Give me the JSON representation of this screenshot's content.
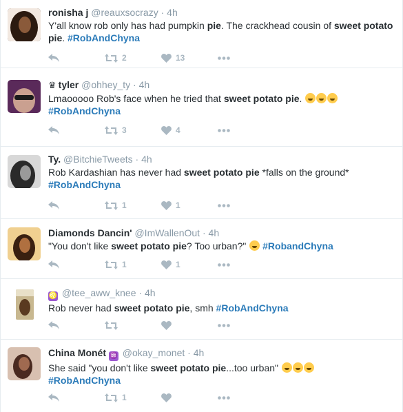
{
  "tweets": [
    {
      "name": "ronisha j",
      "handle": "@reauxsocrazy",
      "time": "4h",
      "text": {
        "t1": "Y'all know rob only has had pumpkin ",
        "b1": "pie",
        "t2": ". The crackhead cousin of ",
        "b2": "sweet potato pie",
        "t3": ". ",
        "hashtag": "#RobAndChyna"
      },
      "retweets": "2",
      "likes": "13",
      "avatar_color": "#3a2418"
    },
    {
      "name": "tyler",
      "handle": "@ohhey_ty",
      "time": "4h",
      "text": {
        "t1": "Lmaooooo Rob's face when he tried that ",
        "b1": "sweet potato pie",
        "t2": ". ",
        "hashtag": "#RobAndChyna"
      },
      "retweets": "3",
      "likes": "4",
      "avatar_color": "#4a2050",
      "crown_icon": "crown-icon"
    },
    {
      "name": "Ty.",
      "handle": "@BitchieTweets",
      "time": "4h",
      "text": {
        "t1": "Rob Kardashian has never had ",
        "b1": "sweet potato pie",
        "t2": " *falls on the ground*",
        "hashtag": "#RobAndChyna"
      },
      "retweets": "1",
      "likes": "1",
      "avatar_color": "#6b6b6b"
    },
    {
      "name": "Diamonds Dancin'",
      "handle": "@ImWallenOut",
      "time": "4h",
      "text": {
        "t1": "\"You don't like ",
        "b1": "sweet potato pie",
        "t2": "? Too urban?\"",
        "hashtag": "#RobandChyna"
      },
      "retweets": "1",
      "likes": "1",
      "avatar_color": "#c98a3a"
    },
    {
      "name": "",
      "handle": "@tee_aww_knee",
      "time": "4h",
      "text": {
        "t1": "Rob never had ",
        "b1": "sweet potato pie",
        "t2": ", smh ",
        "hashtag": "#RobAndChyna"
      },
      "retweets": "",
      "likes": "",
      "avatar_color": "#8b6a3a",
      "badge": "♌"
    },
    {
      "name": "China Monét",
      "handle": "@okay_monet",
      "time": "4h",
      "text": {
        "t1": "She said \"you don't like ",
        "b1": "sweet potato pie",
        "t2": "...too urban\"",
        "hashtag": "#RobAndChyna"
      },
      "retweets": "1",
      "likes": "",
      "avatar_color": "#7a4a3a",
      "badge": "♒"
    }
  ],
  "separator": " · "
}
